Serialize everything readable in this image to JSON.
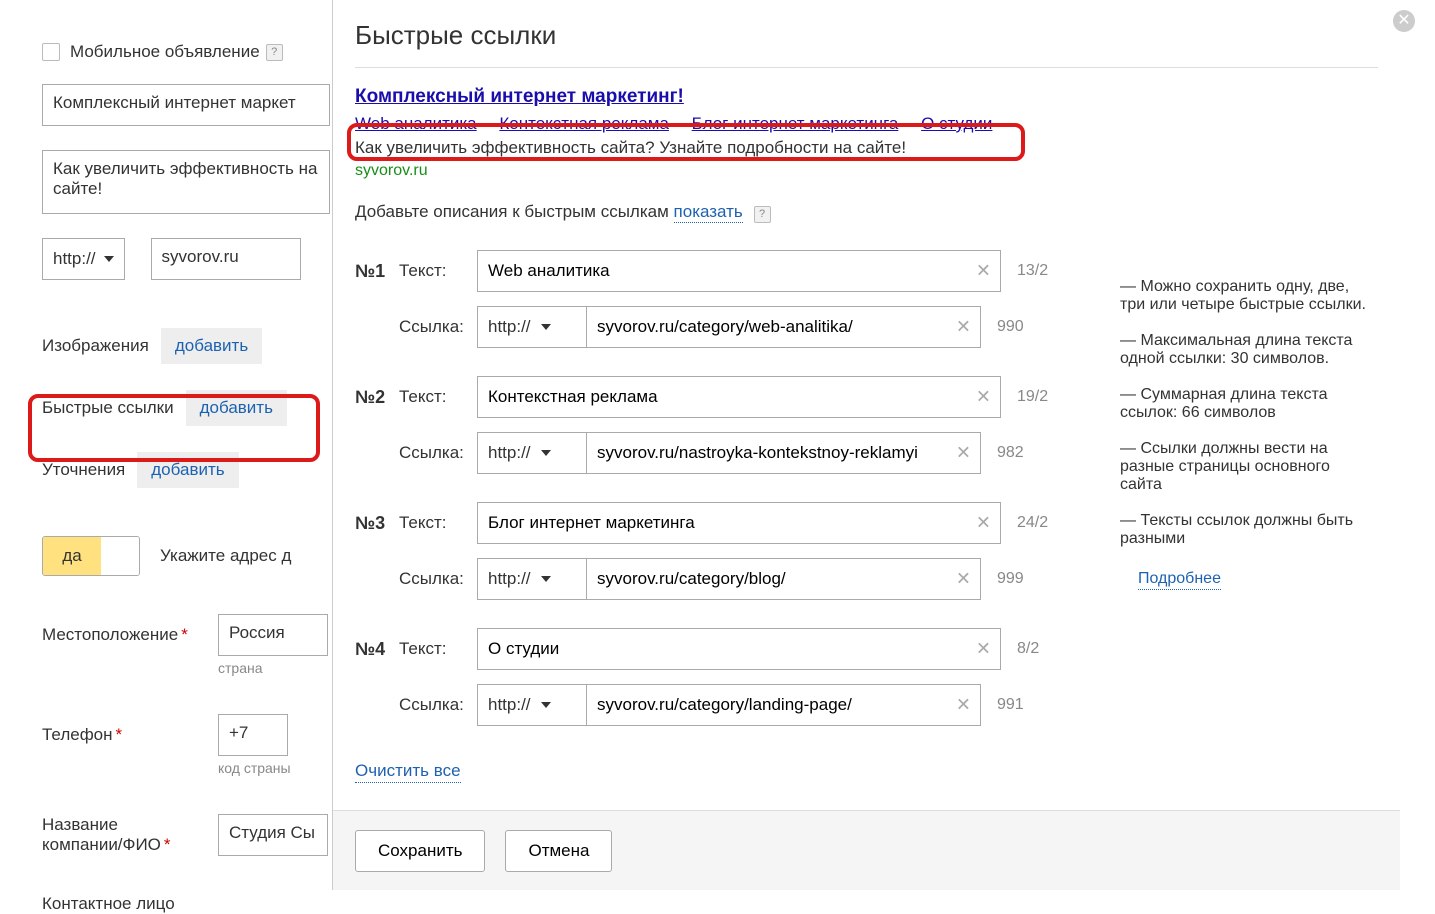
{
  "left": {
    "mobile_ad_label": "Мобильное объявление",
    "headline": "Комплексный интернет маркет",
    "description": "Как увеличить эффективность на сайте!",
    "protocol": "http://",
    "domain": "syvorov.ru",
    "images_label": "Изображения",
    "add_label": "добавить",
    "quicklinks_label": "Быстрые ссылки",
    "clarifications_label": "Уточнения",
    "toggle_yes": "да",
    "toggle_hint": "Укажите адрес д",
    "location_label": "Местоположение",
    "location_value": "Россия",
    "location_sub": "страна",
    "phone_label": "Телефон",
    "phone_code": "+7",
    "phone_sub": "код страны",
    "company_label_1": "Название",
    "company_label_2": "компании/ФИО",
    "company_value": "Студия Сы",
    "contact_label": "Контактное лицо"
  },
  "dialog": {
    "title": "Быстрые ссылки",
    "ad": {
      "title": "Комплексный интернет маркетинг!",
      "sitelinks": [
        "Web аналитика",
        "Контекстная реклама",
        "Блог интернет маркетинга",
        "О студии"
      ],
      "desc": "Как увеличить эффективность сайта? Узнайте подробности на сайте!",
      "url": "syvorov.ru"
    },
    "desc_hint_pre": "Добавьте описания к быстрым ссылкам ",
    "desc_hint_link": "показать",
    "rows": [
      {
        "num": "№1",
        "text_label": "Текст:",
        "link_label": "Ссылка:",
        "text": "Web аналитика",
        "proto": "http://",
        "url": "syvorov.ru/category/web-analitika/",
        "text_counter": "13/2",
        "url_counter": "990"
      },
      {
        "num": "№2",
        "text_label": "Текст:",
        "link_label": "Ссылка:",
        "text": "Контекстная реклама",
        "proto": "http://",
        "url": "syvorov.ru/nastroyka-kontekstnoy-reklamyi",
        "text_counter": "19/2",
        "url_counter": "982"
      },
      {
        "num": "№3",
        "text_label": "Текст:",
        "link_label": "Ссылка:",
        "text": "Блог интернет маркетинга",
        "proto": "http://",
        "url": "syvorov.ru/category/blog/",
        "text_counter": "24/2",
        "url_counter": "999"
      },
      {
        "num": "№4",
        "text_label": "Текст:",
        "link_label": "Ссылка:",
        "text": "О студии",
        "proto": "http://",
        "url": "syvorov.ru/category/landing-page/",
        "text_counter": "8/2",
        "url_counter": "991"
      }
    ],
    "clear_all": "Очистить все",
    "save": "Сохранить",
    "cancel": "Отмена"
  },
  "info": {
    "items": [
      "Можно сохранить одну, две, три или четыре быстрые ссылки.",
      "Максимальная длина текста одной ссылки: 30 символов.",
      "Суммарная длина текста ссылок: 66 символов",
      "Ссылки должны вести на разные страницы основного сайта",
      "Тексты ссылок должны быть разными"
    ],
    "more": "Подробнее"
  }
}
